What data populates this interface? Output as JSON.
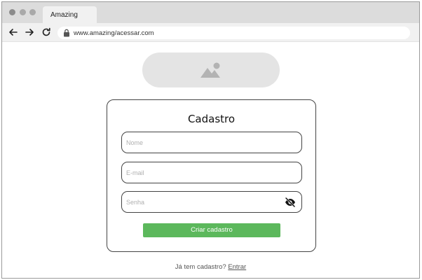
{
  "browser": {
    "tab_title": "Amazing",
    "url": "www.amazing/acessar.com",
    "icons": {
      "back": "arrow-left-icon",
      "forward": "arrow-right-icon",
      "reload": "reload-icon",
      "lock": "lock-icon"
    }
  },
  "logo": {
    "icon": "image-placeholder-icon"
  },
  "form": {
    "title": "Cadastro",
    "name_placeholder": "Nome",
    "email_placeholder": "E-mail",
    "password_placeholder": "Senha",
    "password_toggle_icon": "eye-off-icon",
    "submit_label": "Criar cadastro",
    "submit_color": "#5cb85c"
  },
  "footer": {
    "prompt": "Já tem cadastro?",
    "link_label": "Entrar"
  }
}
